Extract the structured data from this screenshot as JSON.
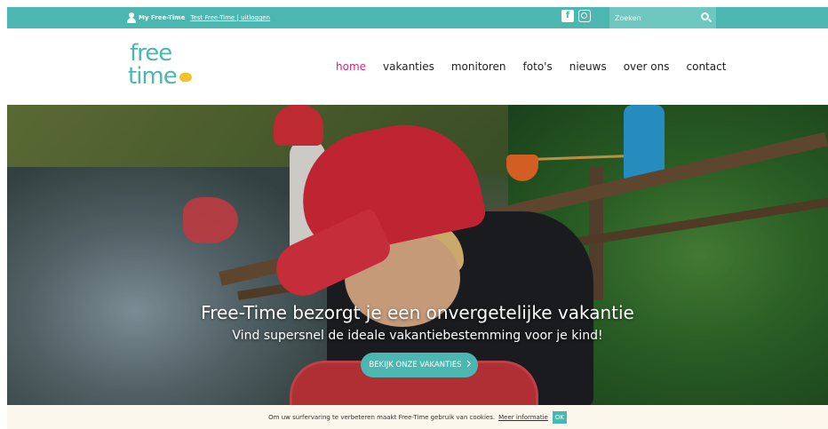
{
  "topbar": {
    "my_label": "My Free-Time",
    "account_text": "Test Free-Time",
    "separator": "|",
    "logout_text": "uitloggen",
    "search_placeholder": "Zoeken",
    "bg_color": "#4cb7b0"
  },
  "logo": {
    "line1": "free",
    "line2": "time"
  },
  "nav": {
    "items": [
      {
        "label": "home",
        "active": true
      },
      {
        "label": "vakanties",
        "active": false
      },
      {
        "label": "monitoren",
        "active": false
      },
      {
        "label": "foto's",
        "active": false
      },
      {
        "label": "nieuws",
        "active": false
      },
      {
        "label": "over ons",
        "active": false
      },
      {
        "label": "contact",
        "active": false
      }
    ],
    "active_color": "#d0267d"
  },
  "hero": {
    "headline": "Free-Time bezorgt je een onvergetelijke vakantie",
    "subline": "Vind supersnel de ideale vakantiebestemming voor je kind!",
    "cta_label": "BEKIJK ONZE VAKANTIES"
  },
  "cookie": {
    "message": "Om uw surfervaring te verbeteren maakt Free-Time gebruik van cookies.",
    "more_link": "Meer informatie",
    "ok_label": "OK"
  },
  "icons": {
    "user": "user-icon",
    "facebook": "facebook-icon",
    "instagram": "instagram-icon",
    "search": "search-icon",
    "chevron": "chevron-right-icon"
  }
}
